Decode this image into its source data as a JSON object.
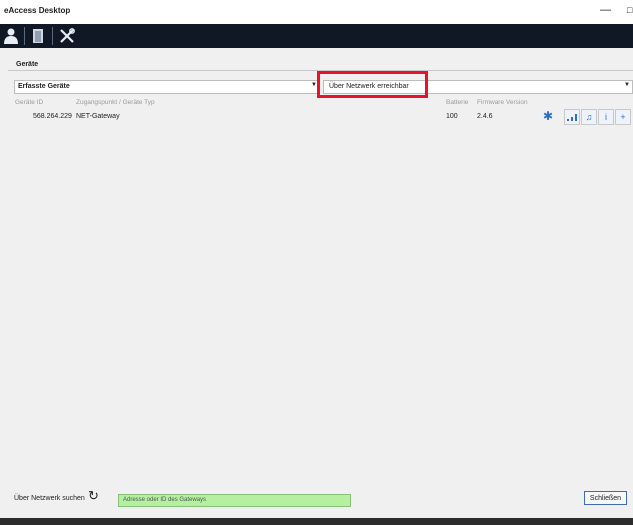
{
  "window": {
    "title": "eAccess Desktop",
    "minimize": "—",
    "maximize": "□"
  },
  "toolbar": {
    "items": [
      {
        "icon": "user-icon"
      },
      {
        "icon": "door-icon"
      },
      {
        "icon": "tools-icon"
      }
    ]
  },
  "section": {
    "title": "Geräte"
  },
  "filters": {
    "device_filter": "Erfasste Geräte",
    "reach_filter": "Über Netzwerk erreichbar",
    "arrow": "▼"
  },
  "table": {
    "columns": {
      "device_id": "Geräte ID",
      "access_point": "Zugangspunkt / Geräte Typ",
      "battery": "Batterie",
      "firmware": "Firmware Version"
    },
    "rows": [
      {
        "device_id": "568.264.229",
        "access_point": "NET-Gateway",
        "battery": "100",
        "firmware": "2.4.6",
        "status_glyph": "✱",
        "actions": [
          "▁▃▅",
          "♫",
          "i",
          "+"
        ]
      }
    ]
  },
  "bottom": {
    "search_label": "Über Netzwerk suchen",
    "refresh_glyph": "↻",
    "address_placeholder": "Adresse oder ID des Gateways",
    "close_label": "Schließen"
  }
}
